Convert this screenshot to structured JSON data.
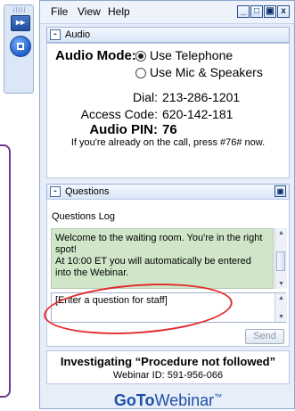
{
  "menu": {
    "file": "File",
    "view": "View",
    "help": "Help"
  },
  "window_controls": {
    "minimize": "_",
    "restore": "□",
    "maximize": "▣",
    "close": "x"
  },
  "toolstrip": {
    "arrows": "▸▸"
  },
  "audio": {
    "section_title": "Audio",
    "mode_label": "Audio Mode:",
    "options": [
      {
        "label": "Use Telephone",
        "selected": true
      },
      {
        "label": "Use Mic & Speakers",
        "selected": false
      }
    ],
    "dial_label": "Dial:",
    "dial_value": "213-286-1201",
    "access_label": "Access Code:",
    "access_value": "620-142-181",
    "pin_label": "Audio PIN:",
    "pin_value": "76",
    "note": "If you're already on the call, press #76# now."
  },
  "questions": {
    "section_title": "Questions",
    "log_label": "Questions Log",
    "log_text": "Welcome to the waiting room.  You're in the right spot!\nAt 10:00 ET you will automatically be entered into the Webinar.",
    "input_value": "[Enter a question for staff]",
    "send_label": "Send"
  },
  "webinar": {
    "title": "Investigating “Procedure not followed”",
    "id_text": "Webinar ID: 591-956-066"
  },
  "brand": {
    "part1": "GoTo",
    "part2": "Webinar",
    "tm": "™"
  },
  "colors": {
    "brand_blue": "#1f4fa6",
    "callout_red": "#e22a2a",
    "log_green": "#cfe7c8",
    "frame_purple": "#6a3c86"
  }
}
